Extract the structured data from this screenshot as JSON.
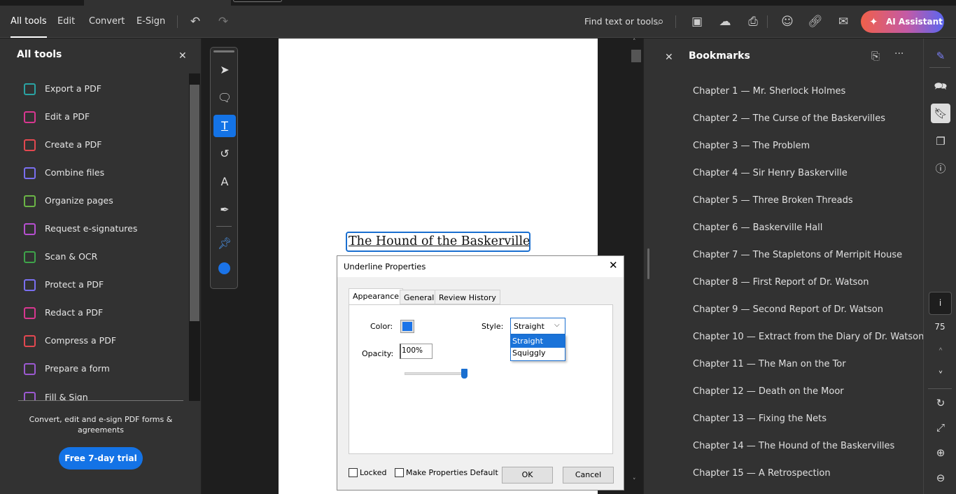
{
  "toolbar": {
    "tabs": [
      "All tools",
      "Edit",
      "Convert",
      "E-Sign"
    ],
    "active_tab": "All tools",
    "search": "Find text or tools",
    "ai_assistant": "AI Assistant"
  },
  "left_panel": {
    "title": "All tools",
    "tools": [
      {
        "label": "Export a PDF",
        "color": "#2aa3a3"
      },
      {
        "label": "Edit a PDF",
        "color": "#d83790"
      },
      {
        "label": "Create a PDF",
        "color": "#e34850"
      },
      {
        "label": "Combine files",
        "color": "#7a6ff0"
      },
      {
        "label": "Organize pages",
        "color": "#6bb546"
      },
      {
        "label": "Request e-signatures",
        "color": "#b64fd0"
      },
      {
        "label": "Scan & OCR",
        "color": "#3ea34a"
      },
      {
        "label": "Protect a PDF",
        "color": "#7a6ff0"
      },
      {
        "label": "Redact a PDF",
        "color": "#d83790"
      },
      {
        "label": "Compress a PDF",
        "color": "#e34850"
      },
      {
        "label": "Prepare a form",
        "color": "#9b59d0"
      },
      {
        "label": "Fill & Sign",
        "color": "#9b59d0"
      }
    ],
    "promo": "Convert, edit and e-sign PDF forms & agreements",
    "trial_button": "Free 7-day trial"
  },
  "document": {
    "title_text": "The Hound of the Baskervilles"
  },
  "bookmarks": {
    "title": "Bookmarks",
    "items": [
      "Chapter 1 — Mr. Sherlock Holmes",
      "Chapter 2 — The Curse of the Baskervilles",
      "Chapter 3 — The Problem",
      "Chapter 4 — Sir Henry Baskerville",
      "Chapter 5 — Three Broken Threads",
      "Chapter 6 — Baskerville Hall",
      "Chapter 7 — The Stapletons of Merripit House",
      "Chapter 8 — First Report of Dr. Watson",
      "Chapter 9 — Second Report of Dr. Watson",
      "Chapter 10 — Extract from the Diary of Dr. Watson",
      "Chapter 11 — The Man on the Tor",
      "Chapter 12 — Death on the Moor",
      "Chapter 13 — Fixing the Nets",
      "Chapter 14 — The Hound of the Baskervilles",
      "Chapter 15 — A Retrospection"
    ]
  },
  "page_nav": {
    "info": "i",
    "page": "75"
  },
  "dialog": {
    "title": "Underline Properties",
    "tabs": [
      "Appearance",
      "General",
      "Review History"
    ],
    "color_label": "Color:",
    "color": "#1a73e8",
    "style_label": "Style:",
    "style_value": "Straight",
    "style_options": [
      "Straight",
      "Squiggly"
    ],
    "opacity_label": "Opacity:",
    "opacity_value": "100%",
    "opacity_percent": 100,
    "locked": "Locked",
    "make_default": "Make Properties Default",
    "ok": "OK",
    "cancel": "Cancel"
  }
}
